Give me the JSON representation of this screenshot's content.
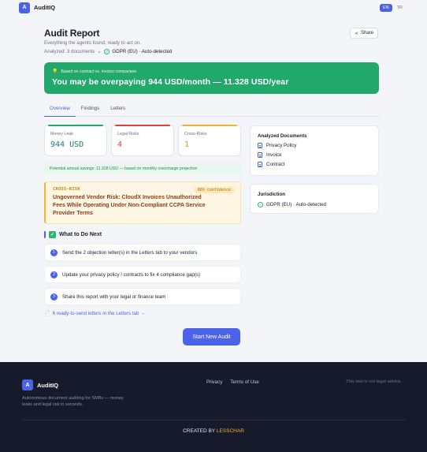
{
  "app": {
    "logo_letter": "A",
    "name": "AuditIQ"
  },
  "languages": [
    {
      "code": "EN",
      "active": true
    },
    {
      "code": "TR",
      "active": false
    }
  ],
  "report": {
    "title": "Audit Report",
    "subtitle": "Everything the agents found, ready to act on.",
    "analyzed": "Analyzed: 3 documents",
    "jurisdiction_inline": "GDPR (EU) · Auto-detected",
    "share_label": "Share"
  },
  "banner": {
    "sub": "Based on contract vs. invoice comparison",
    "main": "You may be overpaying 944 USD/month — 11.328 USD/year",
    "color": "#22a86a"
  },
  "tabs": [
    {
      "label": "Overview",
      "active": true
    },
    {
      "label": "Findings",
      "active": false
    },
    {
      "label": "Letters",
      "active": false
    }
  ],
  "stats": [
    {
      "label": "Money Leak",
      "value": "944 USD",
      "color": "#22a86a"
    },
    {
      "label": "Legal Risks",
      "value": "4",
      "color": "#e0413d"
    },
    {
      "label": "Cross-Risks",
      "value": "1",
      "color": "#f2b233"
    }
  ],
  "savings_note": "Potential annual savings: 11.328 USD — based on monthly overcharge projection",
  "risk": {
    "tag": "CROSS-RISK",
    "confidence": "88% confidence",
    "title": "Ungoverned Vendor Risk: CloudX Invoices Unauthorized Fees While Operating Under Non-Compliant CCPA Service Provider Terms"
  },
  "next": {
    "heading": "What to Do Next",
    "steps": [
      {
        "num": "1",
        "text": "Send the 2 objection letter(s) in the Letters tab to your vendors"
      },
      {
        "num": "2",
        "text": "Update your privacy policy / contracts to fix 4 compliance gap(s)"
      },
      {
        "num": "3",
        "text": "Share this report with your legal or finance team"
      }
    ],
    "letters_link": "6 ready-to-send letters in the Letters tab →",
    "start_button": "Start New Audit"
  },
  "documents": {
    "title": "Analyzed Documents",
    "items": [
      "Privacy Policy",
      "Invoice",
      "Contract"
    ]
  },
  "jurisdiction": {
    "title": "Jurisdiction",
    "value": "GDPR (EU) · Auto-detected"
  },
  "footer": {
    "tagline": "Autonomous document auditing for SMBs — money leaks and legal risk in seconds.",
    "links": [
      "Privacy",
      "Terms of Use"
    ],
    "disclaimer": "This tool is not legal advice.",
    "credit_prefix": "CREATED BY",
    "credit_name": "LESSCHAR"
  }
}
